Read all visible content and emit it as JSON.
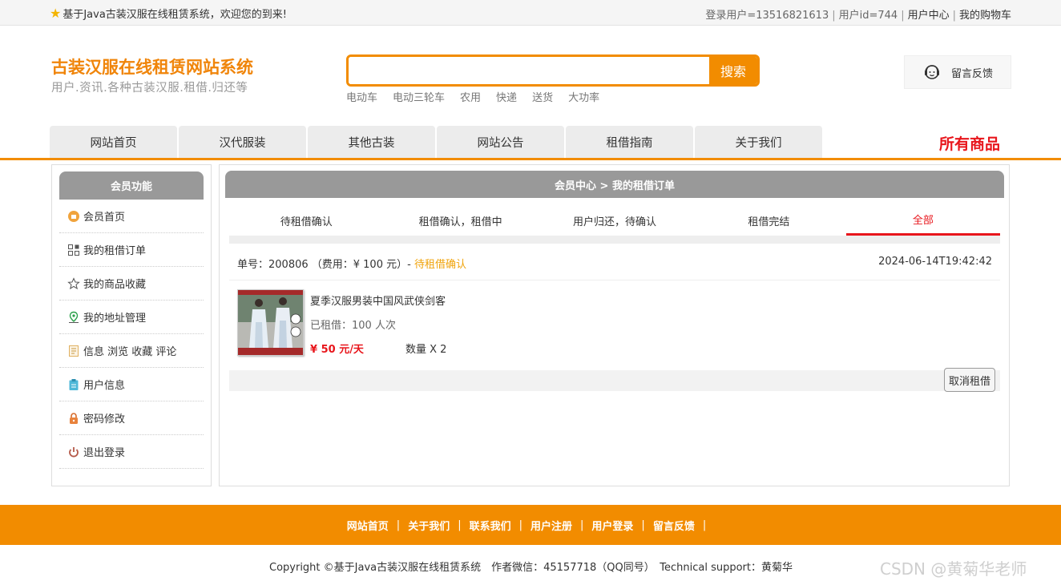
{
  "topbar": {
    "welcome": "基于Java古装汉服在线租赁系统，欢迎您的到来!",
    "user_login": "登录用户=13516821613",
    "user_id": "用户id=744",
    "user_center": "用户中心",
    "cart": "我的购物车"
  },
  "header": {
    "title": "古装汉服在线租赁网站系统",
    "subtitle": "用户.资讯.各种古装汉服.租借.归还等",
    "search_button": "搜索",
    "search_value": "",
    "hotwords": [
      "电动车",
      "电动三轮车",
      "农用",
      "快递",
      "送货",
      "大功率"
    ],
    "feedback": "留言反馈"
  },
  "nav": {
    "tabs": [
      "网站首页",
      "汉代服装",
      "其他古装",
      "网站公告",
      "租借指南",
      "关于我们"
    ],
    "all_goods": "所有商品"
  },
  "sidebar": {
    "title": "会员功能",
    "items": [
      "会员首页",
      "我的租借订单",
      "我的商品收藏",
      "我的地址管理",
      "信息 浏览 收藏 评论",
      "用户信息",
      "密码修改",
      "退出登录"
    ]
  },
  "main": {
    "breadcrumb": "会员中心 > 我的租借订单",
    "tabs": [
      "待租借确认",
      "租借确认，租借中",
      "用户归还，待确认",
      "租借完结",
      "全部"
    ],
    "active_tab": 4,
    "order": {
      "number_text": "单号：200806 （费用：¥ 100 元）- ",
      "status": "待租借确认",
      "time": "2024-06-14T19:42:42",
      "product_name": "夏季汉服男装中国风武侠剑客",
      "rented": "已租借：100 人次",
      "price": "¥ 50 元/天",
      "quantity": "数量 X 2",
      "cancel_button": "取消租借"
    }
  },
  "footer": {
    "links": [
      "网站首页",
      "关于我们",
      "联系我们",
      "用户注册",
      "用户登录",
      "留言反馈"
    ],
    "copyright": "Copyright ©基于Java古装汉服在线租赁系统　作者微信：45157718（QQ同号）　Technical support：黄菊华",
    "watermark": "CSDN @黄菊华老师"
  },
  "colors": {
    "accent": "#f28c00",
    "red": "#e8161c",
    "status": "#f0a30a",
    "header_gray": "#999999"
  }
}
